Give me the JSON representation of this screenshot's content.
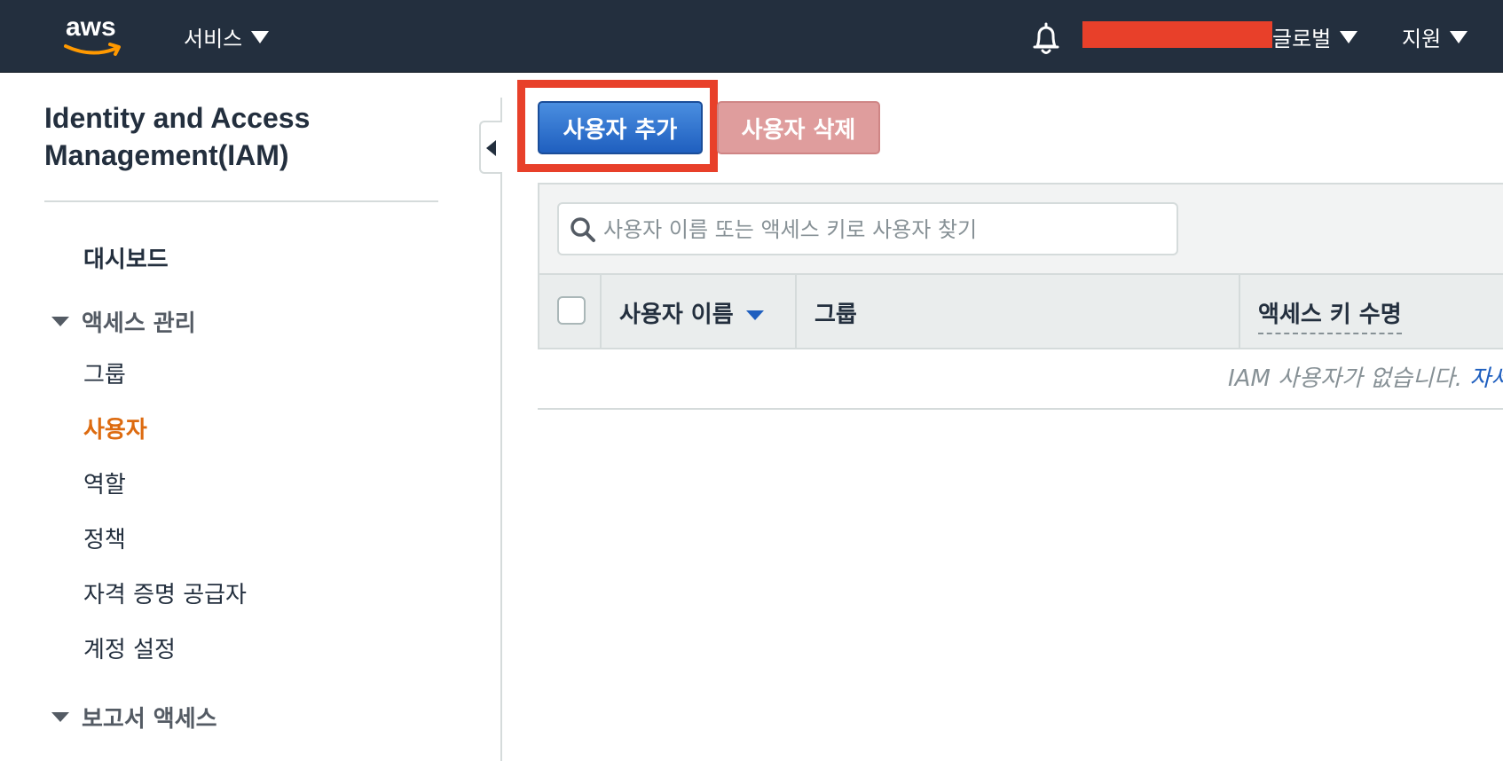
{
  "topnav": {
    "logo_text": "aws",
    "services_label": "서비스",
    "region_label": "글로벌",
    "support_label": "지원"
  },
  "sidebar": {
    "title": "Identity and Access Management(IAM)",
    "dashboard": "대시보드",
    "access_mgmt_section": "액세스 관리",
    "items": [
      {
        "label": "그룹"
      },
      {
        "label": "사용자",
        "active": true
      },
      {
        "label": "역할"
      },
      {
        "label": "정책"
      },
      {
        "label": "자격 증명 공급자"
      },
      {
        "label": "계정 설정"
      }
    ],
    "report_section": "보고서 액세스"
  },
  "toolbar": {
    "add_user_label": "사용자 추가",
    "delete_user_label": "사용자 삭제"
  },
  "search": {
    "placeholder": "사용자 이름 또는 액세스 키로 사용자 찾기"
  },
  "table": {
    "columns": [
      "사용자 이름",
      "그룹",
      "액세스 키 수명"
    ],
    "empty_message": "IAM 사용자가 없습니다.",
    "empty_link": "자세"
  },
  "colors": {
    "nav_bg": "#232f3e",
    "active_item": "#dd6b10",
    "primary_button": "#1f5fbf",
    "highlight": "#e8402a"
  }
}
